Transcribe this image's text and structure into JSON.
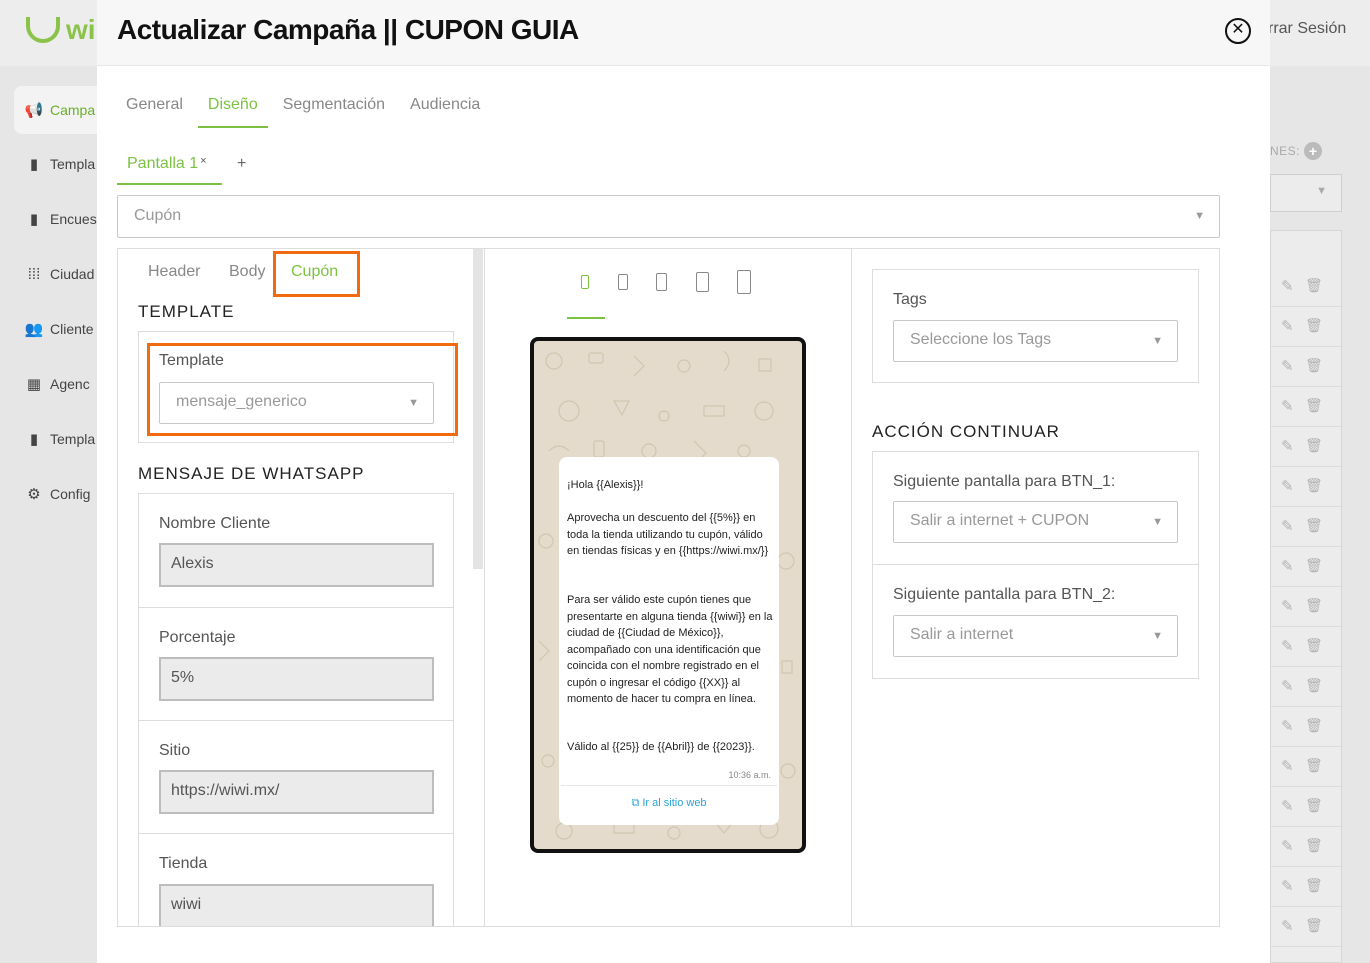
{
  "background": {
    "logo_text": "wi",
    "logout_label": "rrar Sesión",
    "sidebar": [
      {
        "label": "Campa",
        "icon": "megaphone-icon"
      },
      {
        "label": "Templa",
        "icon": "template-icon"
      },
      {
        "label": "Encues",
        "icon": "clipboard-icon"
      },
      {
        "label": "Ciudad",
        "icon": "grid-dots-icon"
      },
      {
        "label": "Cliente",
        "icon": "users-icon"
      },
      {
        "label": "Agenc",
        "icon": "building-icon"
      },
      {
        "label": "Templa",
        "icon": "template-icon"
      },
      {
        "label": "Config",
        "icon": "gear-icon"
      }
    ],
    "right_label": "NES:"
  },
  "modal": {
    "title": "Actualizar Campaña || CUPON GUIA",
    "tabs": [
      {
        "label": "General"
      },
      {
        "label": "Diseño",
        "active": true
      },
      {
        "label": "Segmentación"
      },
      {
        "label": "Audiencia"
      }
    ],
    "screen_tab": "Pantalla 1",
    "screen_close": "×",
    "screen_add": "+",
    "type_select": "Cupón",
    "left": {
      "sub_tabs": [
        "Header",
        "Body",
        "Cupón"
      ],
      "active_sub_tab": "Cupón",
      "template_section": "TEMPLATE",
      "template_label": "Template",
      "template_value": "mensaje_generico",
      "whatsapp_section": "MENSAJE DE WHATSAPP",
      "fields": [
        {
          "label": "Nombre Cliente",
          "value": "Alexis"
        },
        {
          "label": "Porcentaje",
          "value": "5%"
        },
        {
          "label": "Sitio",
          "value": "https://wiwi.mx/"
        },
        {
          "label": "Tienda",
          "value": "wiwi"
        }
      ]
    },
    "preview": {
      "greeting": "¡Hola {{Alexis}}!",
      "paragraph1": "Aprovecha un descuento del {{5%}} en toda la tienda utilizando tu cupón, válido en tiendas físicas y en {{https://wiwi.mx/}}",
      "paragraph2": "Para ser válido este cupón tienes que presentarte en alguna tienda {{wiwi}} en la ciudad de {{Ciudad de México}}, acompañado con una identificación que coincida con el nombre registrado en el cupón o ingresar el código {{XX}} al momento de hacer tu compra en línea.",
      "paragraph3": "Válido al {{25}} de {{Abril}} de {{2023}}.",
      "time": "10:36 a.m.",
      "link_label": "Ir al sitio web"
    },
    "right": {
      "tags_label": "Tags",
      "tags_placeholder": "Seleccione los Tags",
      "accion_section": "ACCIÓN CONTINUAR",
      "btn1_label": "Siguiente pantalla para BTN_1:",
      "btn1_value": "Salir a internet + CUPON",
      "btn2_label": "Siguiente pantalla para BTN_2:",
      "btn2_value": "Salir a internet"
    }
  },
  "colors": {
    "accent_green": "#7cc242",
    "highlight_orange": "#f26a10"
  }
}
